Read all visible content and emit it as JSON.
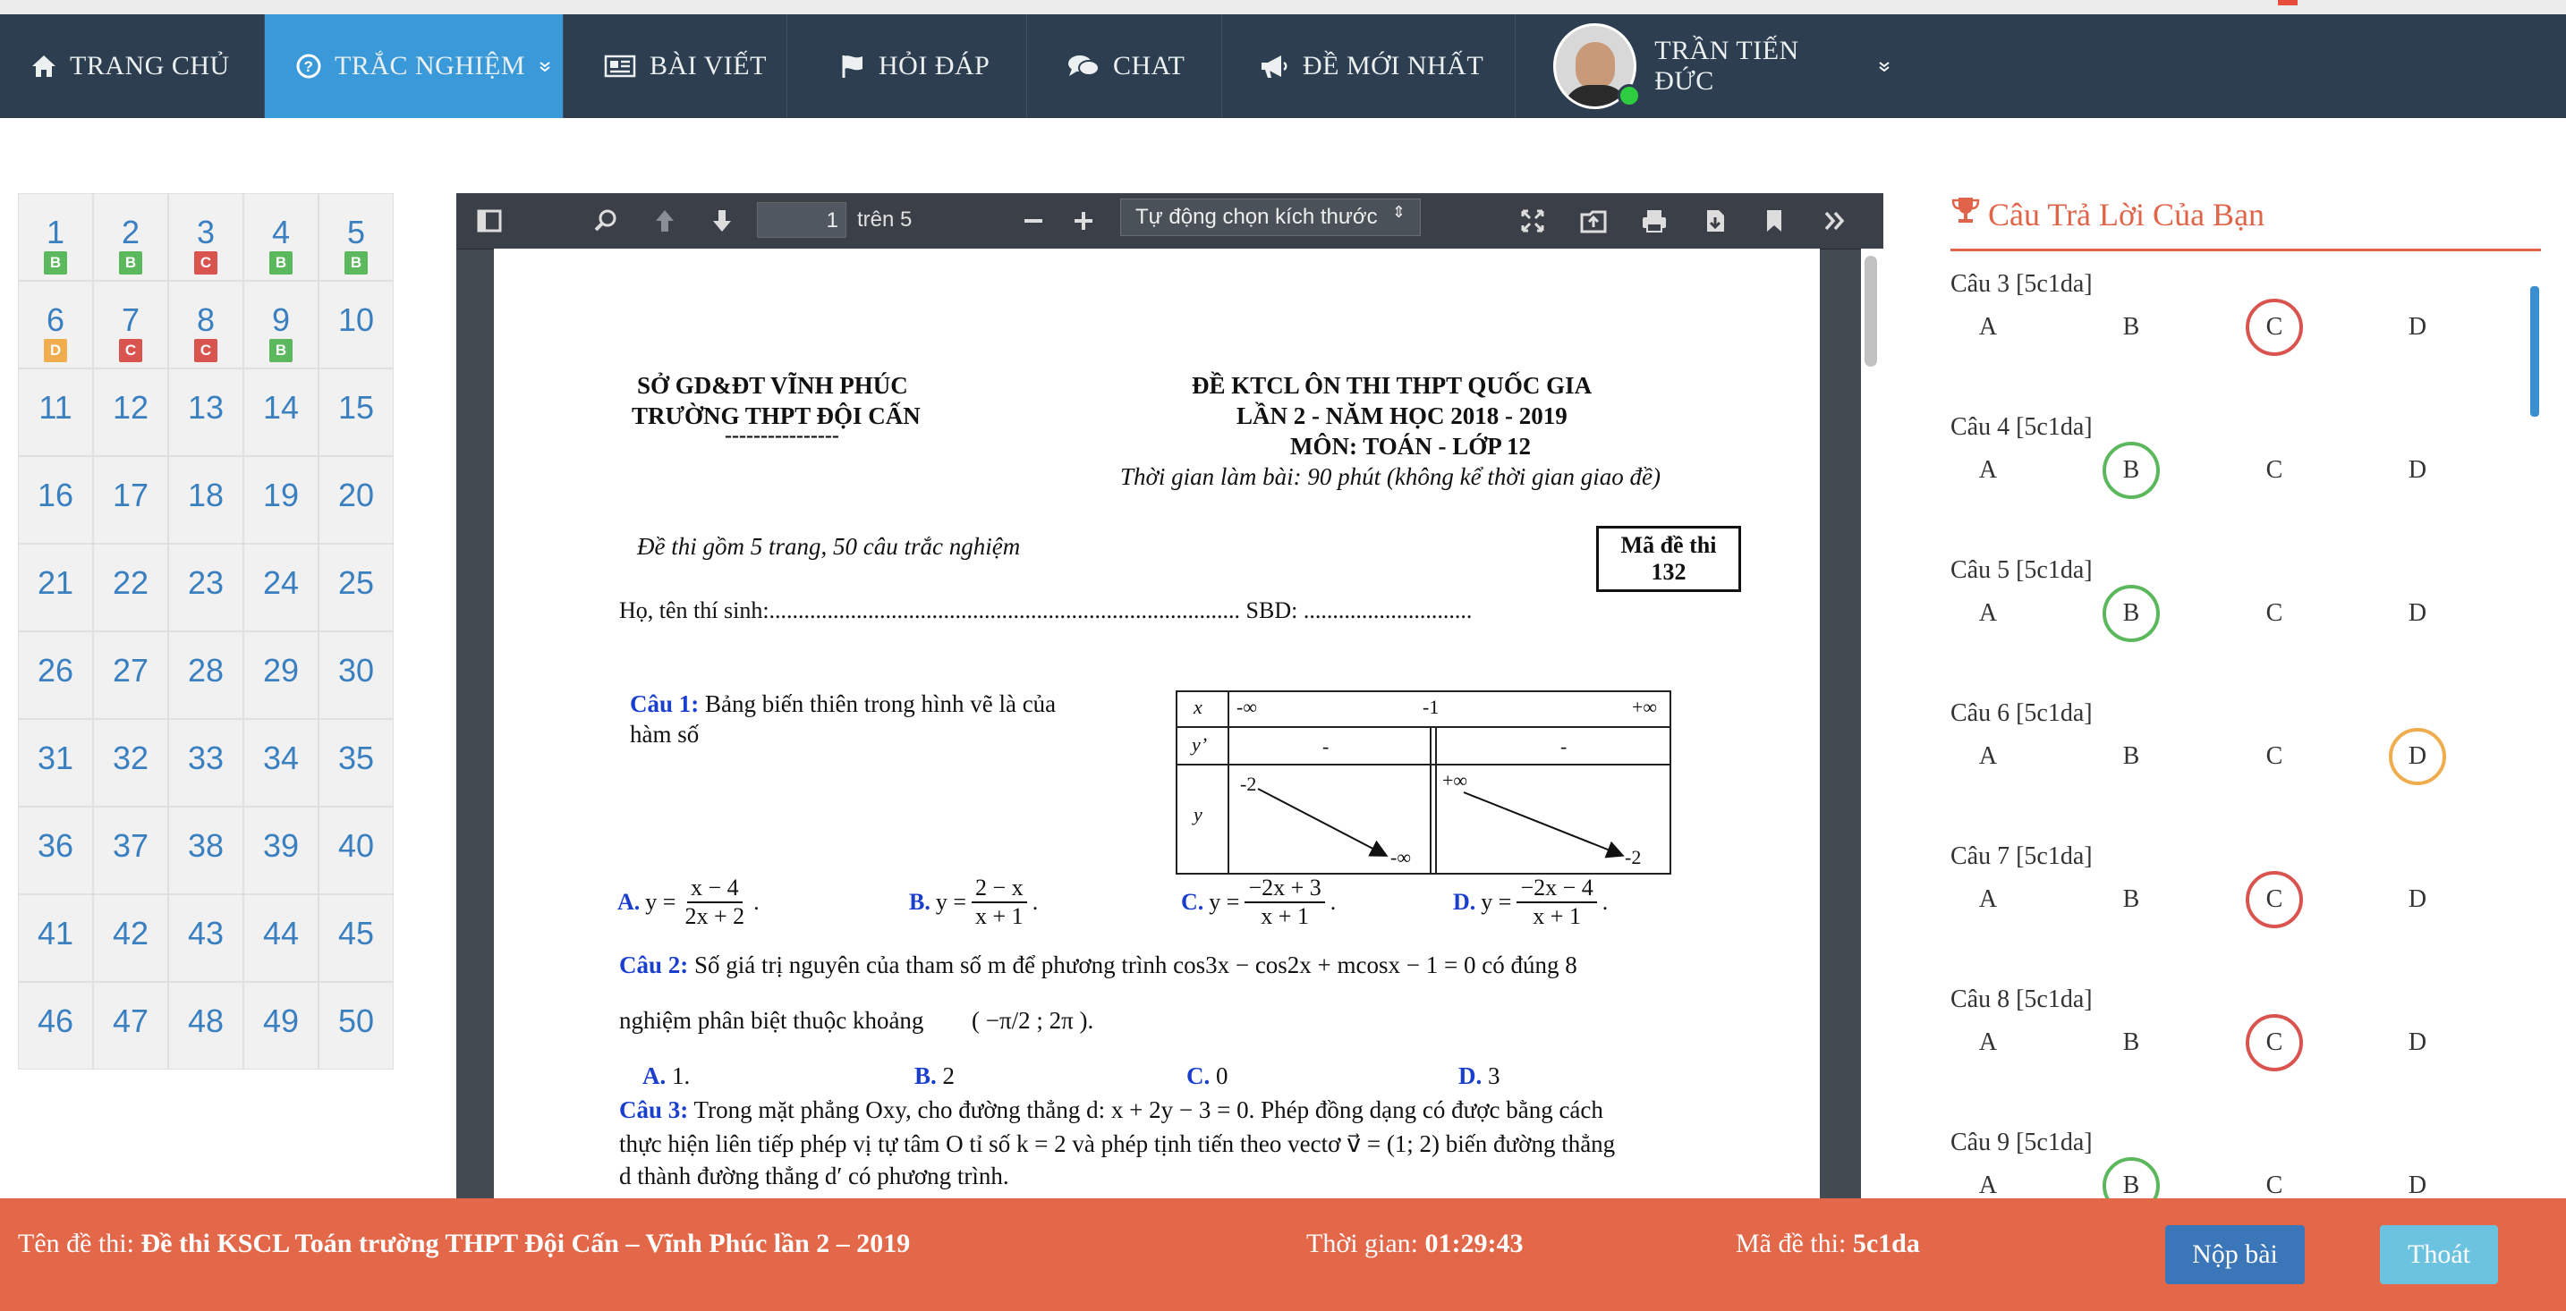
{
  "nav": {
    "items": [
      {
        "label": "TRANG CHỦ",
        "icon": "home-icon"
      },
      {
        "label": "TRẮC NGHIỆM",
        "icon": "question-circle-icon",
        "active": true
      },
      {
        "label": "BÀI VIẾT",
        "icon": "newspaper-icon"
      },
      {
        "label": "HỎI ĐÁP",
        "icon": "flag-icon"
      },
      {
        "label": "CHAT",
        "icon": "comments-icon"
      },
      {
        "label": "ĐỀ MỚI NHẤT",
        "icon": "bullhorn-icon"
      }
    ],
    "user": {
      "name": "TRẦN TIẾN ĐỨC",
      "online": true
    }
  },
  "question_grid": {
    "questions": [
      {
        "n": "1",
        "answer": "B"
      },
      {
        "n": "2",
        "answer": "B"
      },
      {
        "n": "3",
        "answer": "C"
      },
      {
        "n": "4",
        "answer": "B"
      },
      {
        "n": "5",
        "answer": "B"
      },
      {
        "n": "6",
        "answer": "D"
      },
      {
        "n": "7",
        "answer": "C"
      },
      {
        "n": "8",
        "answer": "C"
      },
      {
        "n": "9",
        "answer": "B"
      },
      {
        "n": "10",
        "answer": ""
      },
      {
        "n": "11"
      },
      {
        "n": "12"
      },
      {
        "n": "13"
      },
      {
        "n": "14"
      },
      {
        "n": "15"
      },
      {
        "n": "16"
      },
      {
        "n": "17"
      },
      {
        "n": "18"
      },
      {
        "n": "19"
      },
      {
        "n": "20"
      },
      {
        "n": "21"
      },
      {
        "n": "22"
      },
      {
        "n": "23"
      },
      {
        "n": "24"
      },
      {
        "n": "25"
      },
      {
        "n": "26"
      },
      {
        "n": "27"
      },
      {
        "n": "28"
      },
      {
        "n": "29"
      },
      {
        "n": "30"
      },
      {
        "n": "31"
      },
      {
        "n": "32"
      },
      {
        "n": "33"
      },
      {
        "n": "34"
      },
      {
        "n": "35"
      },
      {
        "n": "36"
      },
      {
        "n": "37"
      },
      {
        "n": "38"
      },
      {
        "n": "39"
      },
      {
        "n": "40"
      },
      {
        "n": "41"
      },
      {
        "n": "42"
      },
      {
        "n": "43"
      },
      {
        "n": "44"
      },
      {
        "n": "45"
      },
      {
        "n": "46"
      },
      {
        "n": "47"
      },
      {
        "n": "48"
      },
      {
        "n": "49"
      },
      {
        "n": "50"
      }
    ],
    "badge_colors": {
      "B": "#5cb85c",
      "C": "#d9534f",
      "D": "#f0ad4e"
    }
  },
  "pdf_viewer": {
    "page_number": "1",
    "page_total": "trên 5",
    "zoom": "Tự động chọn kích thước",
    "document": {
      "left_header_1": "SỞ GD&ĐT VĨNH PHÚC",
      "left_header_2": "TRƯỜNG THPT ĐỘI CẤN",
      "left_header_dash": "----------------",
      "right_header_1": "ĐỀ KTCL ÔN THI THPT QUỐC GIA",
      "right_header_2": "LẦN 2 - NĂM HỌC 2018 - 2019",
      "right_header_3": "MÔN: TOÁN - LỚP 12",
      "time_note": "Thời gian làm bài: 90 phút (không kể thời gian giao đề)",
      "exam_info": "Đề thi gồm 5 trang, 50 câu trắc nghiệm",
      "code_box_1": "Mã đề thi",
      "code_box_2": "132",
      "student_line": "Họ, tên thí sinh:................................................................................. SBD: .............................",
      "q1_label": "Câu 1:",
      "q1_text_1": "Bảng biến thiên trong hình vẽ là của",
      "q1_text_2": "hàm số",
      "table": {
        "x": "x",
        "neg_inf": "-∞",
        "neg_one": "-1",
        "pos_inf": "+∞",
        "yprime": "y’",
        "dash1": "-",
        "dash2": "-",
        "y": "y",
        "top_left": "-2",
        "bot_left": "-∞",
        "top_right": "+∞",
        "bot_right": "-2"
      },
      "q1_opts": [
        {
          "label": "A.",
          "lhs": "y =",
          "num": "x − 4",
          "den": "2x + 2"
        },
        {
          "label": "B.",
          "lhs": "y =",
          "num": "2 − x",
          "den": "x + 1"
        },
        {
          "label": "C.",
          "lhs": "y =",
          "num": "−2x + 3",
          "den": "x + 1"
        },
        {
          "label": "D.",
          "lhs": "y =",
          "num": "−2x − 4",
          "den": "x + 1"
        }
      ],
      "q2_label": "Câu 2:",
      "q2_text": "Số giá trị nguyên của tham số m để phương trình  cos3x − cos2x + mcosx − 1 = 0  có đúng 8",
      "q2_text_2": "nghiệm phân biệt thuộc khoảng",
      "q2_interval": "( −π/2 ; 2π ).",
      "q2_opts": [
        {
          "label": "A.",
          "value": "1."
        },
        {
          "label": "B.",
          "value": "2"
        },
        {
          "label": "C.",
          "value": "0"
        },
        {
          "label": "D.",
          "value": "3"
        }
      ],
      "q3_label": "Câu 3:",
      "q3_text_1": "Trong mặt phẳng Oxy, cho đường thẳng d: x + 2y − 3 = 0. Phép đồng dạng có được bằng cách",
      "q3_text_2": "thực hiện liên tiếp phép vị tự tâm O tỉ số k = 2 và phép tịnh tiến theo vectơ v⃗ = (1; 2) biến đường thẳng",
      "q3_text_3": "d thành đường thẳng d′ có phương trình."
    }
  },
  "answers_panel": {
    "title": "Câu Trả Lời Của Bạn",
    "items": [
      {
        "label": "Câu 3 [5c1da]",
        "selected": "C"
      },
      {
        "label": "Câu 4 [5c1da]",
        "selected": "B"
      },
      {
        "label": "Câu 5 [5c1da]",
        "selected": "B"
      },
      {
        "label": "Câu 6 [5c1da]",
        "selected": "D"
      },
      {
        "label": "Câu 7 [5c1da]",
        "selected": "C"
      },
      {
        "label": "Câu 8 [5c1da]",
        "selected": "C"
      },
      {
        "label": "Câu 9 [5c1da]",
        "selected": "B"
      }
    ],
    "options": [
      "A",
      "B",
      "C",
      "D"
    ],
    "ring_colors": {
      "B": "#5cb85c",
      "C": "#d9534f",
      "D": "#f0ad4e"
    }
  },
  "footer": {
    "exam_name_key": "Tên đề thi:",
    "exam_name": "Đề thi KSCL Toán trường THPT Đội Cấn – Vĩnh Phúc lần 2 – 2019",
    "time_key": "Thời gian:",
    "time": "01:29:43",
    "code_key": "Mã đề thi:",
    "code": "5c1da",
    "submit": "Nộp bài",
    "exit": "Thoát"
  }
}
